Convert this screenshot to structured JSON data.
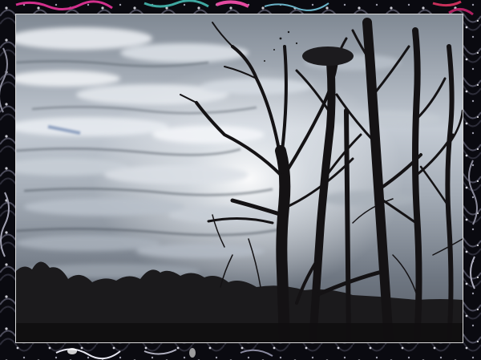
{
  "image": {
    "subject": "bare-trees-silhouette",
    "sky": "overcast-clouds",
    "frame_style": "decorative-border"
  },
  "colors": {
    "sky_light": "#e9eef4",
    "sky_mid": "#9aa3ad",
    "sky_dark": "#4f5660",
    "tree_silhouette": "#141214",
    "frame_accent_pink": "#d2308c",
    "frame_accent_teal": "#3fa7a0",
    "frame_inner_line": "#d8d8d8"
  }
}
